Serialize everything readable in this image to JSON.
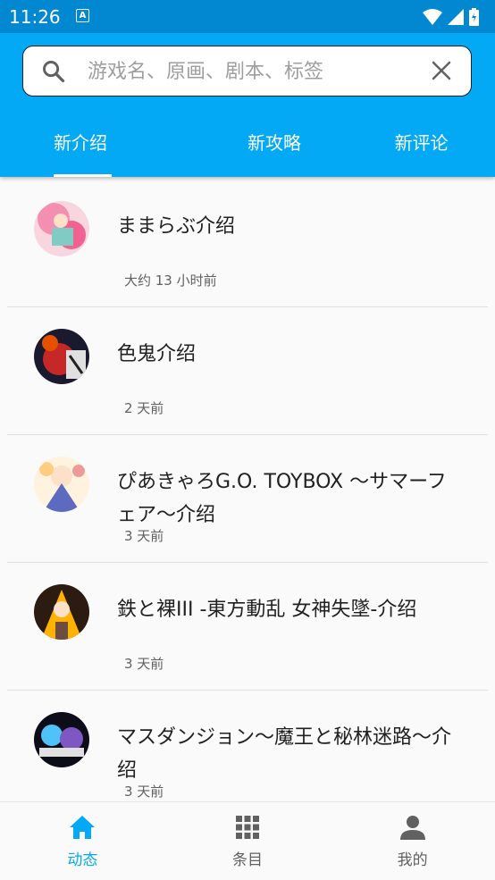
{
  "status_bar": {
    "time": "11:26",
    "notification_glyph": "A"
  },
  "search": {
    "placeholder": "游戏名、原画、剧本、标签",
    "value": ""
  },
  "tabs": [
    {
      "label": "新介绍",
      "active": true
    },
    {
      "label": "新攻略",
      "active": false
    },
    {
      "label": "新评论",
      "active": false
    }
  ],
  "items": [
    {
      "title": "ままらぶ介绍",
      "time": "大约 13 小时前"
    },
    {
      "title": "色鬼介绍",
      "time": "2 天前"
    },
    {
      "title": "ぴあきゃろG.O. TOYBOX ～サマーフェア～介绍",
      "time": "3 天前"
    },
    {
      "title": "鉄と裸III -東方動乱 女神失墜-介绍",
      "time": "3 天前"
    },
    {
      "title": "マスダンジョン～魔王と秘林迷路～介绍",
      "time": "3 天前"
    }
  ],
  "bottom_nav": [
    {
      "label": "动态",
      "icon": "home-icon",
      "active": true
    },
    {
      "label": "条目",
      "icon": "grid-icon",
      "active": false
    },
    {
      "label": "我的",
      "icon": "person-icon",
      "active": false
    }
  ],
  "colors": {
    "accent": "#03a9f4",
    "status_bar": "#0288d1"
  }
}
